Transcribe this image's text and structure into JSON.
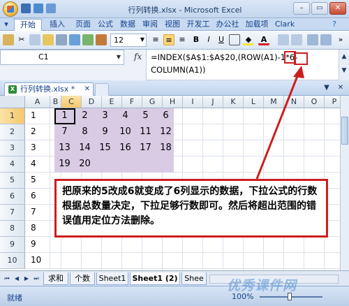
{
  "window": {
    "title": "行列转换.xlsx - Microsoft Excel",
    "minimize": "–",
    "restore": "▭",
    "close": "✕"
  },
  "ribbon_tabs": [
    "开始",
    "插入",
    "页面",
    "公式",
    "数据",
    "审阅",
    "视图",
    "开发工",
    "办公社",
    "加载项",
    "Clark"
  ],
  "toolbar": {
    "font_size": "12",
    "bold": "B",
    "italic": "I",
    "underline": "U"
  },
  "name_box": "C1",
  "fx_label": "fx",
  "formula": {
    "line1_prefix": "=INDEX($A$1:$A$20,(ROW(A1)-1",
    "highlight": "*6",
    "line1_suffix": "-",
    "line2": "COLUMN(A1))"
  },
  "workbook_tab": "行列转换.xlsx *",
  "columns": [
    "A",
    "B",
    "C",
    "D",
    "E",
    "F",
    "G",
    "H",
    "I",
    "J",
    "K",
    "L",
    "M",
    "N",
    "O",
    "P"
  ],
  "rows": [
    "1",
    "2",
    "3",
    "4",
    "5",
    "6",
    "7",
    "8",
    "9",
    "10"
  ],
  "column_a": [
    "1",
    "2",
    "3",
    "4",
    "5",
    "6",
    "7",
    "8",
    "9",
    "10"
  ],
  "matrix": [
    [
      "1",
      "2",
      "3",
      "4",
      "5",
      "6"
    ],
    [
      "7",
      "8",
      "9",
      "10",
      "11",
      "12"
    ],
    [
      "13",
      "14",
      "15",
      "16",
      "17",
      "18"
    ],
    [
      "19",
      "20",
      "",
      "",
      "",
      ""
    ]
  ],
  "callout": "把原来的5改成6就变成了6列显示的数据，下拉公式的行数根据总数量决定，下拉足够行数即可。然后将超出范围的错误值用定位方法删除。",
  "sheet_tabs": [
    "求和",
    "个数",
    "Sheet1",
    "Sheet1 (2)",
    "Shee"
  ],
  "active_sheet": "Sheet1 (2)",
  "status": "就绪",
  "zoom": "100%",
  "watermark": "优秀课件网",
  "colors": {
    "selection_fill": "#d9cbe4",
    "callout_border": "#cc1e1e",
    "ribbon_blue": "#c8daf1"
  }
}
